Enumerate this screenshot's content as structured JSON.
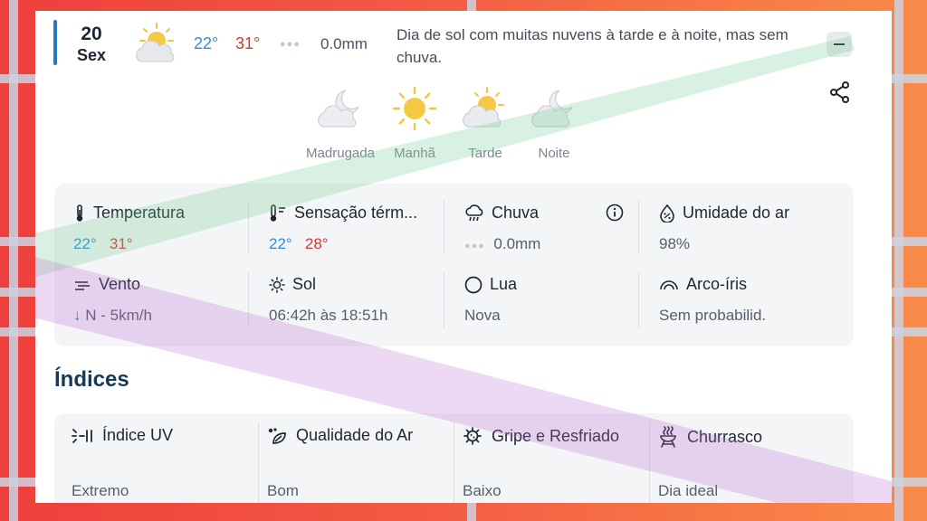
{
  "day": {
    "number": "20",
    "weekday": "Sex",
    "temp_min": "22°",
    "temp_max": "31°",
    "rain": "0.0mm",
    "description": "Dia de sol com muitas nuvens à tarde e à noite, mas sem chuva.",
    "icon": "sun-cloud-icon"
  },
  "periods": [
    {
      "label": "Madrugada",
      "icon": "moon-cloud-icon"
    },
    {
      "label": "Manhã",
      "icon": "sun-icon"
    },
    {
      "label": "Tarde",
      "icon": "sun-cloud-icon"
    },
    {
      "label": "Noite",
      "icon": "moon-cloud-icon"
    }
  ],
  "details": {
    "temperatura": {
      "title": "Temperatura",
      "min": "22°",
      "max": "31°"
    },
    "sensacao": {
      "title": "Sensação térm...",
      "min": "22°",
      "max": "28°"
    },
    "chuva": {
      "title": "Chuva",
      "value": "0.0mm"
    },
    "umidade": {
      "title": "Umidade do ar",
      "value": "98%"
    },
    "vento": {
      "title": "Vento",
      "value": "N - 5km/h",
      "arrow": "↓"
    },
    "sol": {
      "title": "Sol",
      "value": "06:42h às 18:51h"
    },
    "lua": {
      "title": "Lua",
      "value": "Nova"
    },
    "arcoiris": {
      "title": "Arco-íris",
      "value": "Sem probabilid."
    }
  },
  "indices": {
    "title": "Índices",
    "items": [
      {
        "title": "Índice UV",
        "value": "Extremo",
        "icon": "uv-index-icon"
      },
      {
        "title": "Qualidade do Ar",
        "value": "Bom",
        "icon": "leaf-icon"
      },
      {
        "title": "Gripe e Resfriado",
        "value": "Baixo",
        "icon": "virus-icon"
      },
      {
        "title": "Churrasco",
        "value": "Dia ideal",
        "icon": "grill-icon"
      }
    ]
  },
  "colors": {
    "temp_min": "#2d8fd0",
    "temp_max": "#d5372f",
    "day_bar": "#2c79b6",
    "indices_title": "#173955"
  }
}
